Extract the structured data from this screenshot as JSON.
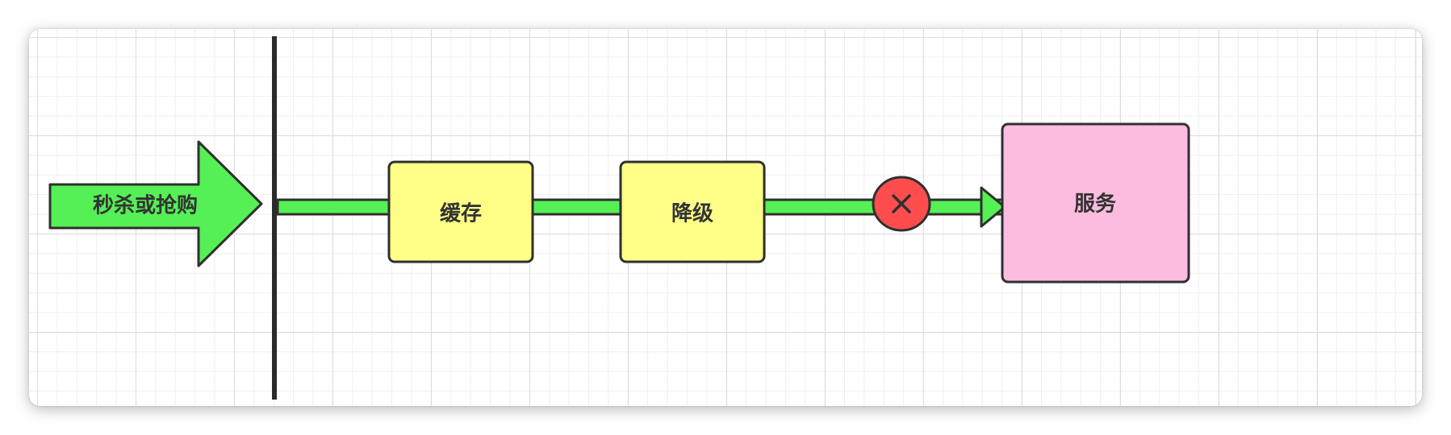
{
  "diagram": {
    "entry_arrow_label": "秒杀或抢购",
    "cache_label": "缓存",
    "degrade_label": "降级",
    "blocked_icon": "close-icon",
    "service_label": "服务"
  },
  "colors": {
    "entry_arrow_fill": "#55f055",
    "flow_line": "#55f055",
    "cache_fill": "#ffff88",
    "degrade_fill": "#ffff88",
    "blocked_fill": "#ff4d4d",
    "service_fill": "#fcbcdf",
    "stroke": "#2f2f2f"
  }
}
